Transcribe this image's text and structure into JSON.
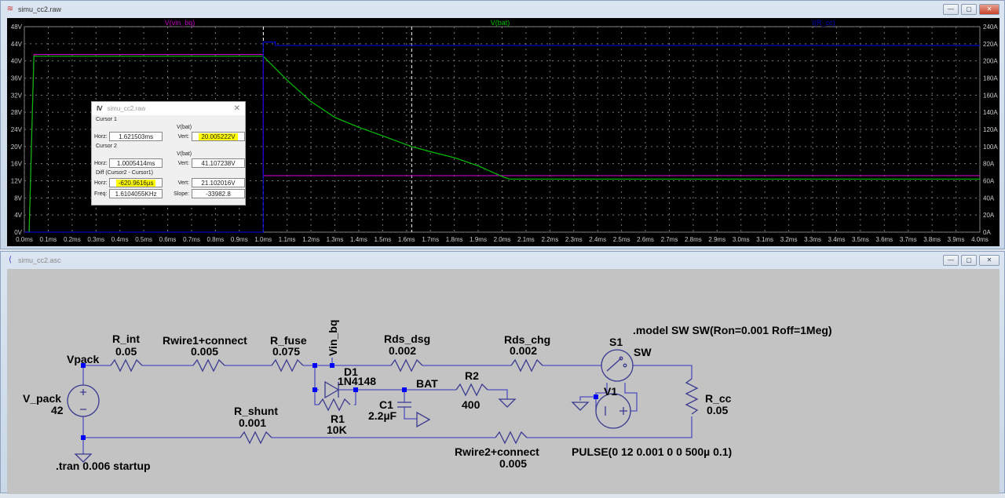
{
  "plot_window": {
    "title": "simu_cc2.raw",
    "traces": [
      {
        "label": "V(vin_bq)",
        "color": "#c000c0",
        "axis": "left",
        "points": [
          [
            0,
            0
          ],
          [
            0.02,
            0
          ],
          [
            0.04,
            41.5
          ],
          [
            1.0,
            41.5
          ],
          [
            1.0,
            13.2
          ],
          [
            4.0,
            13.2
          ]
        ]
      },
      {
        "label": "V(bat)",
        "color": "#00c000",
        "axis": "left",
        "points": [
          [
            0,
            0
          ],
          [
            0.02,
            0
          ],
          [
            0.04,
            41.1
          ],
          [
            1.0,
            41.1
          ],
          [
            1.1,
            35.5
          ],
          [
            1.2,
            30.5
          ],
          [
            1.3,
            26.8
          ],
          [
            1.4,
            24.5
          ],
          [
            1.5,
            22.5
          ],
          [
            1.62,
            20.0
          ],
          [
            1.7,
            18.8
          ],
          [
            1.8,
            17.4
          ],
          [
            1.9,
            15.5
          ],
          [
            2.0,
            13.0
          ],
          [
            2.03,
            12.4
          ],
          [
            4.0,
            12.4
          ]
        ]
      },
      {
        "label": "I(R_cc)",
        "color": "#0000c8",
        "axis": "right",
        "points": [
          [
            0,
            0
          ],
          [
            1.0,
            0
          ],
          [
            1.0,
            222
          ],
          [
            1.05,
            222
          ],
          [
            1.05,
            218
          ],
          [
            4.0,
            218
          ]
        ]
      }
    ],
    "x_ticks": [
      "0.0ms",
      "0.1ms",
      "0.2ms",
      "0.3ms",
      "0.4ms",
      "0.5ms",
      "0.6ms",
      "0.7ms",
      "0.8ms",
      "0.9ms",
      "1.0ms",
      "1.1ms",
      "1.2ms",
      "1.3ms",
      "1.4ms",
      "1.5ms",
      "1.6ms",
      "1.7ms",
      "1.8ms",
      "1.9ms",
      "2.0ms",
      "2.1ms",
      "2.2ms",
      "2.3ms",
      "2.4ms",
      "2.5ms",
      "2.6ms",
      "2.7ms",
      "2.8ms",
      "2.9ms",
      "3.0ms",
      "3.1ms",
      "3.2ms",
      "3.3ms",
      "3.4ms",
      "3.5ms",
      "3.6ms",
      "3.7ms",
      "3.8ms",
      "3.9ms",
      "4.0ms"
    ],
    "left_ticks": [
      "0V",
      "4V",
      "8V",
      "12V",
      "16V",
      "20V",
      "24V",
      "28V",
      "32V",
      "36V",
      "40V",
      "44V",
      "48V"
    ],
    "right_ticks": [
      "0A",
      "20A",
      "40A",
      "60A",
      "80A",
      "100A",
      "120A",
      "140A",
      "160A",
      "180A",
      "200A",
      "220A",
      "240A"
    ],
    "xlim_ms": [
      0,
      4.0
    ],
    "left_ylim": [
      0,
      48
    ],
    "right_ylim": [
      0,
      240
    ],
    "cursors_ms": [
      1.621503,
      1.0005414
    ],
    "cursor_dialog": {
      "title": "simu_cc2.raw",
      "cursor1": "Cursor 1",
      "cursor1_trace": "V(bat)",
      "cursor1_horz": "1.621503ms",
      "cursor1_vert": "20.005222V",
      "cursor2": "Cursor 2",
      "cursor2_trace": "V(bat)",
      "cursor2_horz": "1.0005414ms",
      "cursor2_vert": "41.107238V",
      "diff": "Diff (Cursor2 - Cursor1)",
      "diff_horz": "-620.9616µs",
      "diff_vert": "21.102016V",
      "freq": "1.6104055KHz",
      "slope": "-33982.8",
      "lbl_horz": "Horz:",
      "lbl_vert": "Vert:",
      "lbl_freq": "Freq:",
      "lbl_slope": "Slope:"
    }
  },
  "schematic_window": {
    "title": "simu_cc2.asc",
    "labels": {
      "vpack_net": "Vpack",
      "vsrc_name": "V_pack",
      "vsrc_val": "42",
      "rint_name": "R_int",
      "rint_val": "0.05",
      "rwire1_name": "Rwire1+connect",
      "rwire1_val": "0.005",
      "rfuse_name": "R_fuse",
      "rfuse_val": "0.075",
      "vinbq_net": "Vin_bq",
      "rdsdsg_name": "Rds_dsg",
      "rdsdsg_val": "0.002",
      "rdschg_name": "Rds_chg",
      "rdschg_val": "0.002",
      "model": ".model SW SW(Ron=0.001 Roff=1Meg)",
      "s1_name": "S1",
      "s1_val": "SW",
      "d1_name": "D1",
      "d1_val": "1N4148",
      "bat_net": "BAT",
      "r2_name": "R2",
      "r2_val": "400",
      "c1_name": "C1",
      "c1_val": "2.2µF",
      "r1_name": "R1",
      "r1_val": "10K",
      "v1_name": "V1",
      "rcc_name": "R_cc",
      "rcc_val": "0.05",
      "rshunt_name": "R_shunt",
      "rshunt_val": "0.001",
      "rwire2_name": "Rwire2+connect",
      "rwire2_val": "0.005",
      "pulse": "PULSE(0 12 0.001 0 0 500µ 0.1)",
      "tran": ".tran 0.006 startup"
    }
  }
}
